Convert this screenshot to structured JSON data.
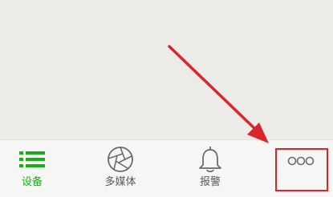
{
  "tabs": [
    {
      "label": "设备",
      "icon": "list-icon",
      "active": true
    },
    {
      "label": "多媒体",
      "icon": "aperture-icon",
      "active": false
    },
    {
      "label": "报警",
      "icon": "bell-icon",
      "active": false
    },
    {
      "label": "",
      "icon": "more-icon",
      "active": false
    }
  ],
  "colors": {
    "active": "#1aad19",
    "inactive": "#5a5a5a",
    "annotation": "#d9262c",
    "background": "#ecebe8",
    "tabbar": "#f6f6f4"
  }
}
